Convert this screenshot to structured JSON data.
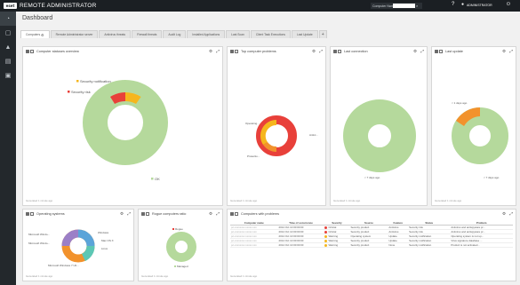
{
  "app": {
    "logo": "eset",
    "title": "REMOTE ADMINISTRATOR"
  },
  "topbar": {
    "search_label": "Computer Name",
    "search_placeholder": "",
    "help_icon": "question-icon",
    "user_label": "ADMINISTRATOR",
    "logout_icon": "logout-icon"
  },
  "sidebar": {
    "items": [
      {
        "icon": "dashboard-icon",
        "glyph": "◔"
      },
      {
        "icon": "computers-icon",
        "glyph": "▢"
      },
      {
        "icon": "threats-icon",
        "glyph": "▲"
      },
      {
        "icon": "reports-icon",
        "glyph": "▤"
      },
      {
        "icon": "admin-icon",
        "glyph": "▣"
      }
    ]
  },
  "page": {
    "title": "Dashboard"
  },
  "tabs": [
    {
      "label": "Computers"
    },
    {
      "label": "Remote Administrator server"
    },
    {
      "label": "Antivirus threats"
    },
    {
      "label": "Firewall threats"
    },
    {
      "label": "Audit Log"
    },
    {
      "label": "Installed Applications"
    },
    {
      "label": "Last Scan"
    },
    {
      "label": "Client Task Executions"
    },
    {
      "label": "Last Update"
    },
    {
      "label": "+"
    }
  ],
  "panels": {
    "status_overview": {
      "title": "Computer statuses overview",
      "footer": "Generated 1 minute ago",
      "labels": {
        "notification": "Security notification",
        "risk": "Security risk",
        "ok": "OK"
      }
    },
    "top_problems": {
      "title": "Top computer problems",
      "footer": "Generated 1 minute ago",
      "labels": {
        "a": "Operating...",
        "b": "Antivi...",
        "c": "Protectio..."
      }
    },
    "last_connection": {
      "title": "Last connection",
      "footer": "Generated 1 minute ago",
      "labels": {
        "a": "< 7 days ago"
      }
    },
    "last_update": {
      "title": "Last update",
      "footer": "Generated 1 minute ago",
      "labels": {
        "a": "< 1 days ago",
        "b": "< 7 days ago"
      }
    },
    "operating_systems": {
      "title": "Operating systems",
      "footer": "Generated 1 minute ago",
      "labels": {
        "a": "Microsoft Windo...",
        "b": "Microsoft Windo...",
        "c": "Windows",
        "d": "Mac OS X",
        "e": "Linux",
        "f": "Microsoft Windows 7 Ult..."
      }
    },
    "rogue_ratio": {
      "title": "Rogue computers ratio",
      "footer": "Generated 1 minute ago",
      "labels": {
        "a": "Rogue",
        "b": "Managed"
      }
    },
    "problems_table": {
      "title": "Computers with problems",
      "footer": "Generated 1 minute ago",
      "columns": [
        "Computer name",
        "Time of occurrence",
        "Severity",
        "Source",
        "Feature",
        "Status",
        "Problem"
      ],
      "rows": [
        [
          "pc-xxxxxxxx.xxxxx.xxx",
          "2014 Oct 10 00:00:00",
          "Critical",
          "Security product",
          "Antivirus",
          "Security risk",
          "Antivirus and antispyware pr..."
        ],
        [
          "pc-xxxxxxxx.xxxxx.xxx",
          "2014 Oct 10 00:00:00",
          "Critical",
          "Security product",
          "Antivirus",
          "Security risk",
          "Antivirus and antispyware pr..."
        ],
        [
          "pc-xxxxxxxx.xxxxx.xxx",
          "2014 Oct 10 00:00:00",
          "Warning",
          "Operating system",
          "Update",
          "Security notification",
          "Operating system is not up..."
        ],
        [
          "pc-xxxxxxxx.xxxxx.xxx",
          "2014 Oct 10 00:00:00",
          "Warning",
          "Security product",
          "Update",
          "Security notification",
          "Virus signature database ..."
        ],
        [
          "pc-xxxxxxxx.xxxxx.xxx",
          "2014 Oct 10 00:00:00",
          "Warning",
          "Security product",
          "None",
          "Security notification",
          "Product is not activated..."
        ]
      ]
    }
  },
  "colors": {
    "ok": "#b5d99c",
    "risk": "#e8403a",
    "notification": "#f5b61d",
    "orange": "#f2922c",
    "purple": "#9b7fc7",
    "blue": "#5ba4d9",
    "teal": "#5cc7b5"
  }
}
